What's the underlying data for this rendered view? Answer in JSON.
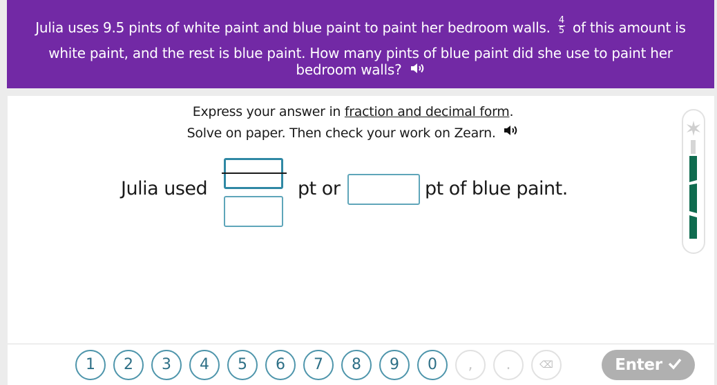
{
  "question": {
    "line1_before": "Julia uses 9.5 pints of white paint and blue paint to paint her bedroom walls.",
    "fraction_numerator": "4",
    "fraction_denominator": "5",
    "line1_after": "of this amount is",
    "line2": "white paint, and the rest is blue paint. How many pints of blue paint did she use to paint her",
    "line3": "bedroom walls?",
    "audio_icon": "speaker-icon",
    "background_color": "#7229a5"
  },
  "instructions": {
    "line1_prefix": "Express your answer in ",
    "line1_link": "fraction and decimal form",
    "line1_suffix": ".",
    "line2": "Solve on paper. Then check your work on Zearn.",
    "audio_icon": "speaker-icon"
  },
  "answer_sentence": {
    "prefix": "Julia used",
    "middle": "pt or",
    "suffix": "pt of blue paint.",
    "numerator_value": "",
    "denominator_value": "",
    "decimal_value": ""
  },
  "progress": {
    "icon": "sparkle-icon",
    "filled_segments": 3,
    "total_segments": 4,
    "fill_color": "#0f6b4f",
    "empty_color": "#d6d6d6"
  },
  "keypad": {
    "keys": [
      "1",
      "2",
      "3",
      "4",
      "5",
      "6",
      "7",
      "8",
      "9",
      "0",
      ",",
      ".",
      "⌫"
    ],
    "enter_label": "Enter",
    "enter_icon": "checkmark-icon",
    "key_color": "#4e95ab",
    "disabled_color": "#e1e1e1"
  }
}
